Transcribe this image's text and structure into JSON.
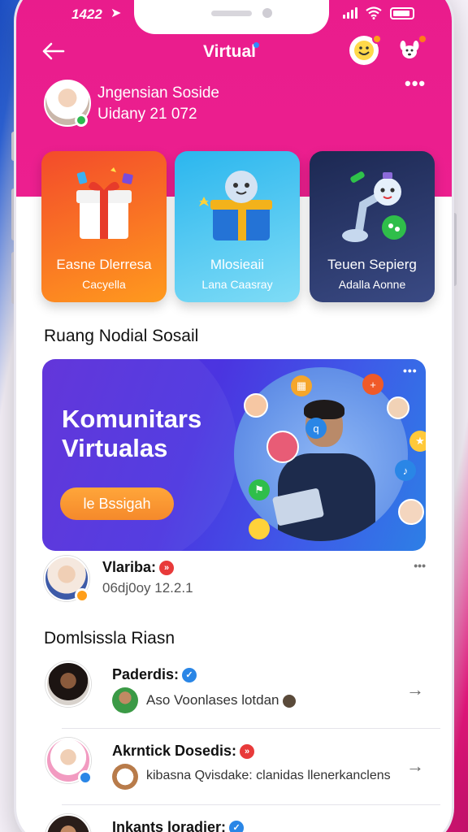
{
  "status": {
    "time": "1422"
  },
  "header": {
    "title": "Virtual"
  },
  "profile": {
    "name": "Jngensian Soside",
    "subtitle": "Uidany 21 072"
  },
  "cards": [
    {
      "title": "Easne Dlerresa",
      "subtitle": "Cacyella",
      "colors": [
        "#f05a28",
        "#fd8f1f"
      ]
    },
    {
      "title": "Mlosieaii",
      "subtitle": "Lana Caasray",
      "colors": [
        "#2fb8ec",
        "#6fd6f5"
      ]
    },
    {
      "title": "Teuen Sepierg",
      "subtitle": "Adalla Aonne",
      "colors": [
        "#1d2a52",
        "#35427a"
      ]
    }
  ],
  "section1": {
    "title": "Ruang Nodial Sosail"
  },
  "banner": {
    "title": "Komunitars Virtualas",
    "button_label": "le Bssigah"
  },
  "post": {
    "name": "Vlariba:",
    "sub": "06dj0oy 12.2.1"
  },
  "section2": {
    "title": "Domlsissla Riasn"
  },
  "list": [
    {
      "name": "Paderdis:",
      "sub": "Aso Voonlases lotdan"
    },
    {
      "name": "Akrntick Dosedis:",
      "sub": "kibasna Qvisdake: clanidas llenerkanclens"
    },
    {
      "name": "Inkants loradier:",
      "sub": ""
    }
  ],
  "icons": {
    "back": "arrow-left-icon",
    "profile_emoji": "smiley-icon",
    "dog": "dog-icon",
    "more": "more-dots-icon",
    "chevron": "chevron-right-icon"
  }
}
